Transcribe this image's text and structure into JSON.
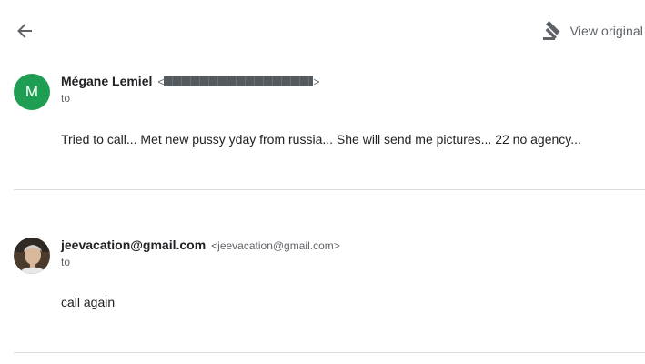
{
  "toolbar": {
    "back_icon": "arrow-back-icon",
    "view_original_icon": "gavel-icon",
    "view_original_label": "View original"
  },
  "messages": [
    {
      "avatar_letter": "M",
      "avatar_color": "#1e9e52",
      "sender_name": "Mégane Lemiel",
      "sender_email_open": "<",
      "sender_email_close": ">",
      "recipient_label": "to",
      "body": "Tried to call... Met new pussy yday from russia... She will send me pictures... 22 no agency..."
    },
    {
      "avatar_icon": "user-photo-avatar",
      "sender_name": "jeevacation@gmail.com",
      "sender_email": "<jeevacation@gmail.com>",
      "recipient_label": "to",
      "body": "call again"
    }
  ]
}
